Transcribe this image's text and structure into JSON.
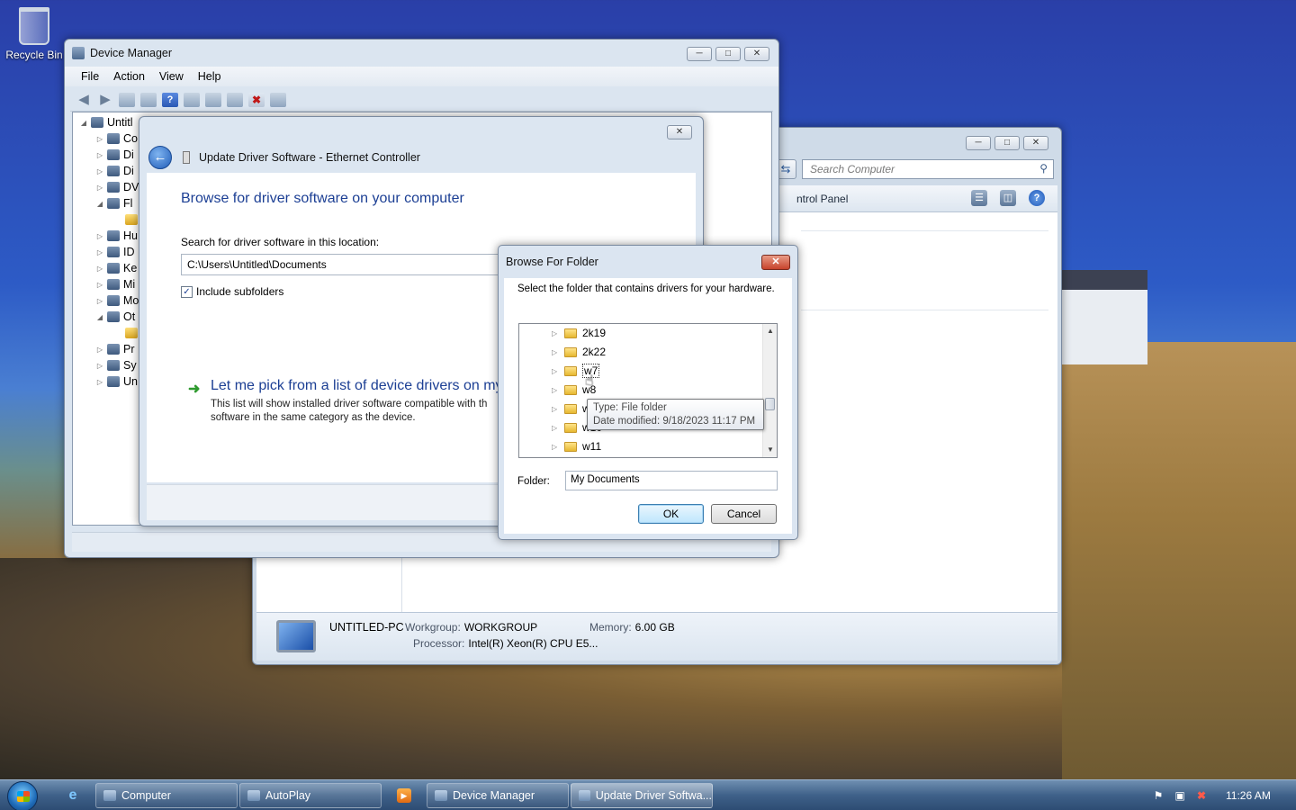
{
  "desktop": {
    "recycle_bin_label": "Recycle Bin"
  },
  "computer_window": {
    "search_placeholder": "Search Computer",
    "toolbar_label": "ntrol Panel",
    "details": {
      "pc_name": "UNTITLED-PC",
      "workgroup_label": "Workgroup:",
      "workgroup_value": "WORKGROUP",
      "memory_label": "Memory:",
      "memory_value": "6.00 GB",
      "processor_label": "Processor:",
      "processor_value": "Intel(R) Xeon(R) CPU E5..."
    }
  },
  "device_manager": {
    "title": "Device Manager",
    "menu": [
      "File",
      "Action",
      "View",
      "Help"
    ],
    "tree": [
      {
        "label": "Untitl",
        "expanded": true
      },
      {
        "label": "Co"
      },
      {
        "label": "Di"
      },
      {
        "label": "Di"
      },
      {
        "label": "DV"
      },
      {
        "label": "Fl",
        "expanded": true
      },
      {
        "label": ""
      },
      {
        "label": "Hu"
      },
      {
        "label": "ID"
      },
      {
        "label": "Ke"
      },
      {
        "label": "Mi"
      },
      {
        "label": "Mo"
      },
      {
        "label": "Ot",
        "expanded": true
      },
      {
        "label": ""
      },
      {
        "label": "Pr"
      },
      {
        "label": "Sy"
      },
      {
        "label": "Un"
      }
    ]
  },
  "update_driver": {
    "title": "Update Driver Software - Ethernet Controller",
    "heading": "Browse for driver software on your computer",
    "search_label": "Search for driver software in this location:",
    "path_value": "C:\\Users\\Untitled\\Documents",
    "include_subfolders_label": "Include subfolders",
    "include_subfolders_checked": true,
    "pick_link": "Let me pick from a list of device drivers on my",
    "pick_desc_line1": "This list will show installed driver software compatible with th",
    "pick_desc_line2": "software in the same category as the device."
  },
  "browse_folder": {
    "title": "Browse For Folder",
    "instruction": "Select the folder that contains drivers for your hardware.",
    "folders": [
      {
        "label": "2k19"
      },
      {
        "label": "2k22"
      },
      {
        "label": "w7",
        "focused": true
      },
      {
        "label": "w8"
      },
      {
        "label": "w"
      },
      {
        "label": "w10"
      },
      {
        "label": "w11"
      }
    ],
    "tooltip_type": "Type: File folder",
    "tooltip_date": "Date modified: 9/18/2023 11:17 PM",
    "folder_label": "Folder:",
    "folder_value": "My Documents",
    "ok_label": "OK",
    "cancel_label": "Cancel"
  },
  "taskbar": {
    "buttons": [
      {
        "label": "Computer"
      },
      {
        "label": "AutoPlay"
      },
      {
        "label": "Device Manager"
      },
      {
        "label": "Update Driver Softwa..."
      }
    ],
    "clock": "11:26 AM"
  }
}
